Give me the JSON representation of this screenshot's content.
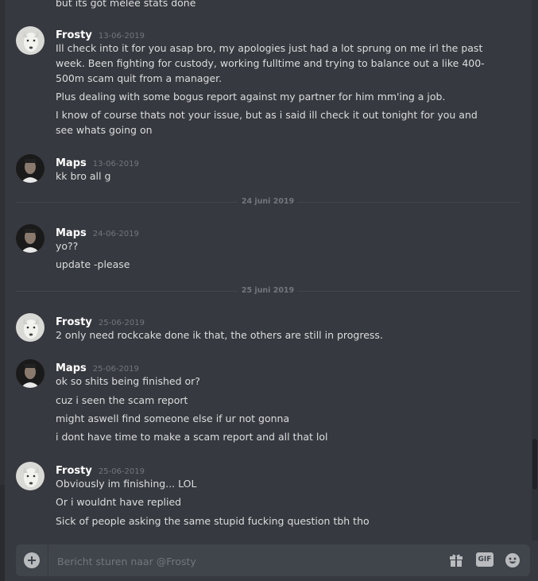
{
  "channel": {
    "recipient": "Frosty",
    "composer_placeholder": "Bericht sturen naar @Frosty",
    "gif_label": "GIF"
  },
  "top_partial_line": "but its got melee stats done",
  "dividers": {
    "d1": "24 juni 2019",
    "d2": "25 juni 2019"
  },
  "messages": {
    "m1": {
      "author": "Frosty",
      "timestamp": "13-06-2019",
      "lines": [
        "Ill check into it for you asap bro, my apologies just had a lot sprung on me irl the past week. Been fighting for custody, working fulltime and trying to balance out a like 400-500m scam quit from a manager.",
        "Plus dealing with some bogus report against my partner for him mm'ing a job.",
        "I know of course thats not your issue, but as i said ill check it out tonight for you and see whats going on"
      ]
    },
    "m2": {
      "author": "Maps",
      "timestamp": "13-06-2019",
      "lines": [
        "kk bro all g"
      ]
    },
    "m3": {
      "author": "Maps",
      "timestamp": "24-06-2019",
      "lines": [
        "yo??",
        "update -please"
      ]
    },
    "m4": {
      "author": "Frosty",
      "timestamp": "25-06-2019",
      "lines": [
        "2 only need rockcake done ik that, the others are still in progress."
      ]
    },
    "m5": {
      "author": "Maps",
      "timestamp": "25-06-2019",
      "lines": [
        "ok so shits being finished or?",
        "cuz i seen the scam report",
        "might aswell find someone else if ur not gonna",
        "i dont have time to make a scam report and all that lol"
      ]
    },
    "m6": {
      "author": "Frosty",
      "timestamp": "25-06-2019",
      "lines": [
        "Obviously im finishing... LOL",
        "Or i wouldnt have replied",
        "Sick of people asking the same stupid fucking question tbh tho"
      ]
    }
  },
  "icons": {
    "upload": "plus-circle-icon",
    "gift": "gift-icon",
    "gif": "gif-icon",
    "emoji": "emoji-icon"
  },
  "colors": {
    "background": "#36393f",
    "composer": "#40444b",
    "text": "#dcddde",
    "author": "#ffffff",
    "muted": "#72767d"
  }
}
